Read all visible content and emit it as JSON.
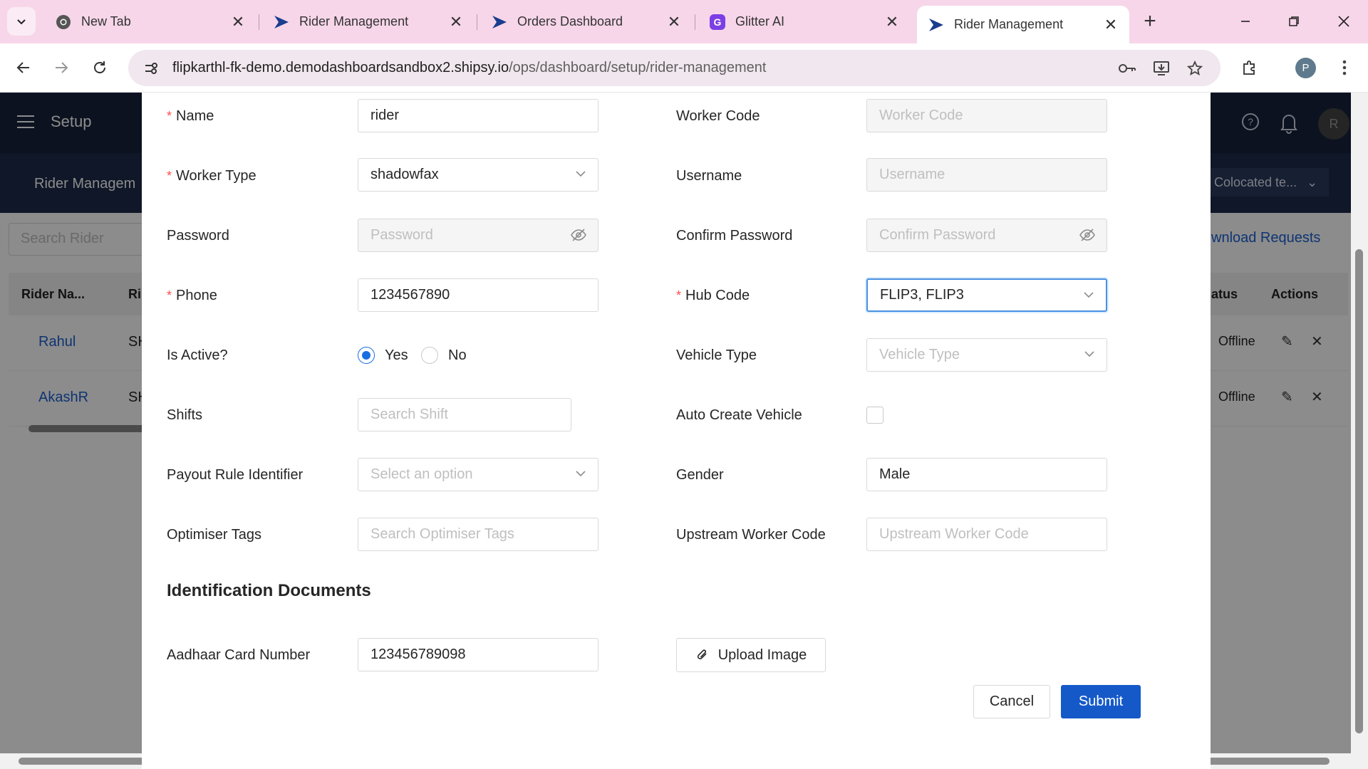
{
  "browser": {
    "tabs": [
      {
        "title": "New Tab",
        "icon": "chrome-icon"
      },
      {
        "title": "Rider Management",
        "icon": "shipsy-icon"
      },
      {
        "title": "Orders Dashboard",
        "icon": "shipsy-icon"
      },
      {
        "title": "Glitter AI",
        "icon": "glitter-icon"
      },
      {
        "title": "Rider Management",
        "icon": "shipsy-icon",
        "active": true
      }
    ],
    "url_host": "flipkarthl-fk-demo.demodashboardsandbox2.shipsy.io",
    "url_path": "/ops/dashboard/setup/rider-management",
    "profile_initial": "P",
    "tabbar_color": "#f7d6e9"
  },
  "app": {
    "header_title": "Setup",
    "page_title": "Rider Managem",
    "avatar_initial": "R",
    "colocated_label": "Colocated te...",
    "search_placeholder": "Search Rider",
    "download_requests": "wnload Requests",
    "table": {
      "col_rider_name": "Rider Na...",
      "col_rider": "Ri",
      "col_status": "atus",
      "col_actions": "Actions",
      "rows": [
        {
          "name": "Rahul",
          "code": "SH",
          "status": "Offline"
        },
        {
          "name": "AkashR",
          "code": "SH",
          "status": "Offline"
        }
      ]
    }
  },
  "form": {
    "name": {
      "label": "Name",
      "value": "rider"
    },
    "worker_code": {
      "label": "Worker Code",
      "placeholder": "Worker Code"
    },
    "worker_type": {
      "label": "Worker Type",
      "value": "shadowfax"
    },
    "username": {
      "label": "Username",
      "placeholder": "Username"
    },
    "password": {
      "label": "Password",
      "placeholder": "Password"
    },
    "confirm_password": {
      "label": "Confirm Password",
      "placeholder": "Confirm Password"
    },
    "phone": {
      "label": "Phone",
      "value": "1234567890"
    },
    "hub_code": {
      "label": "Hub Code",
      "value": "FLIP3, FLIP3"
    },
    "is_active": {
      "label": "Is Active?",
      "yes": "Yes",
      "no": "No",
      "selected": "Yes"
    },
    "vehicle_type": {
      "label": "Vehicle Type",
      "placeholder": "Vehicle Type"
    },
    "shifts": {
      "label": "Shifts",
      "placeholder": "Search Shift"
    },
    "auto_create_vehicle": {
      "label": "Auto Create Vehicle",
      "checked": false
    },
    "payout_rule": {
      "label": "Payout Rule Identifier",
      "placeholder": "Select an option"
    },
    "gender": {
      "label": "Gender",
      "value": "Male"
    },
    "optimiser_tags": {
      "label": "Optimiser Tags",
      "placeholder": "Search Optimiser Tags"
    },
    "upstream_worker_code": {
      "label": "Upstream Worker Code",
      "placeholder": "Upstream Worker Code"
    },
    "id_docs_title": "Identification Documents",
    "aadhaar": {
      "label": "Aadhaar Card Number",
      "value": "123456789098"
    },
    "upload_label": "Upload Image",
    "cancel_label": "Cancel",
    "submit_label": "Submit",
    "primary_color": "#1559c9"
  }
}
